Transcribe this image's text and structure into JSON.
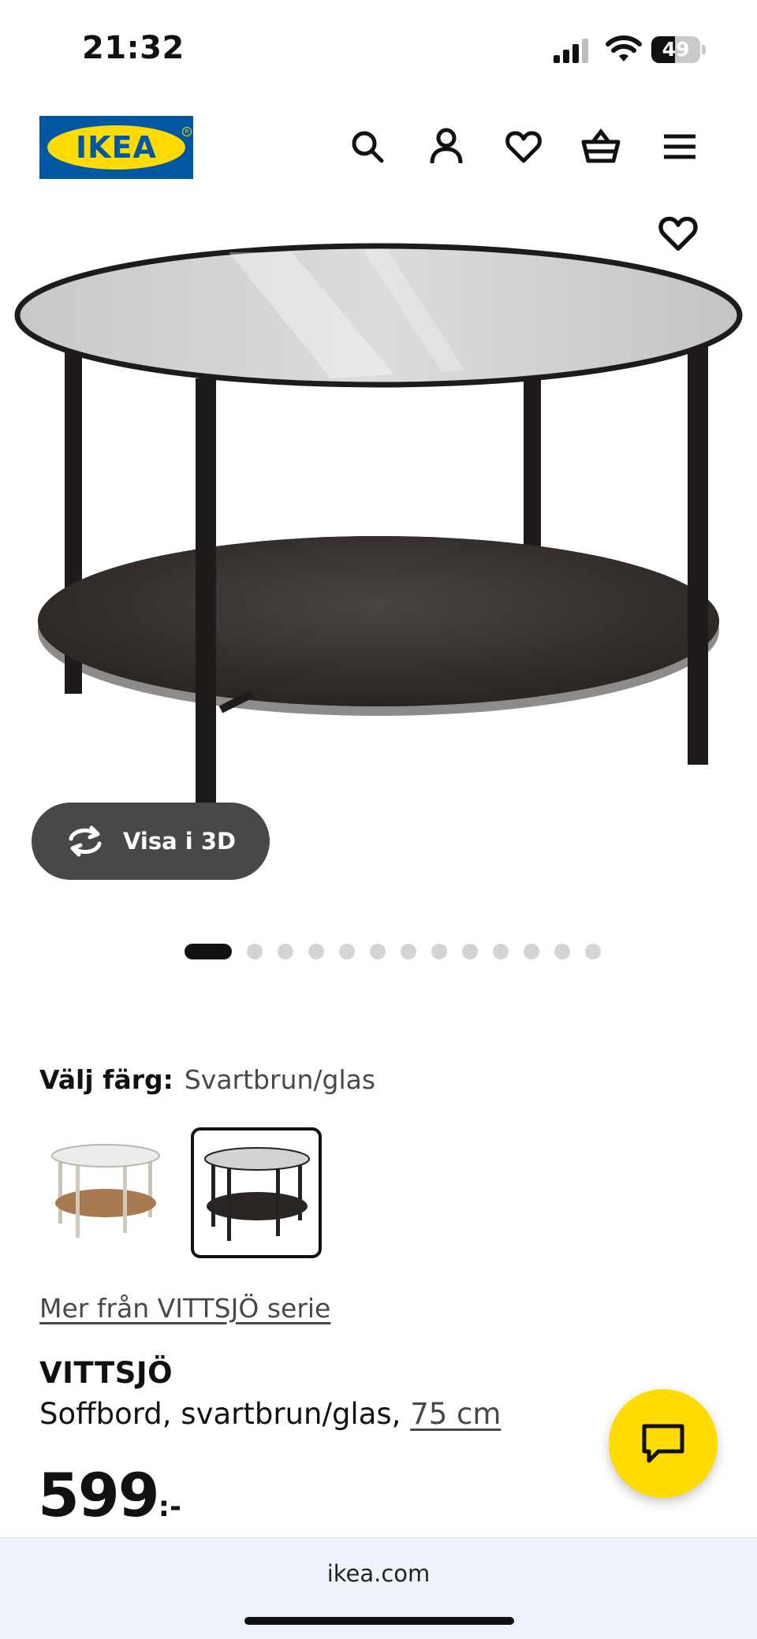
{
  "status_bar": {
    "time": "21:32",
    "battery": "49",
    "battery_level": 0.49
  },
  "header": {
    "logo_text": "IKEA",
    "icons": [
      "search-icon",
      "user-icon",
      "heart-icon",
      "basket-icon",
      "menu-icon"
    ]
  },
  "gallery": {
    "view_3d_label": "Visa i 3D",
    "dot_count": 13,
    "active_index": 0
  },
  "color_selection": {
    "label": "Välj färg:",
    "selected": "Svartbrun/glas",
    "options": [
      "white-stain-oak-table",
      "black-brown-glass-table"
    ],
    "selected_index": 1
  },
  "product": {
    "series_link": "Mer från VITTSJÖ serie",
    "name": "VITTSJÖ",
    "description": "Soffbord, svartbrun/glas, ",
    "size_link": "75 cm",
    "price": "599",
    "price_suffix": ":-"
  },
  "browser": {
    "url": "ikea.com"
  },
  "colors": {
    "brand_blue": "#0058a3",
    "brand_yellow": "#ffdb00",
    "pill_gray": "#484848"
  }
}
